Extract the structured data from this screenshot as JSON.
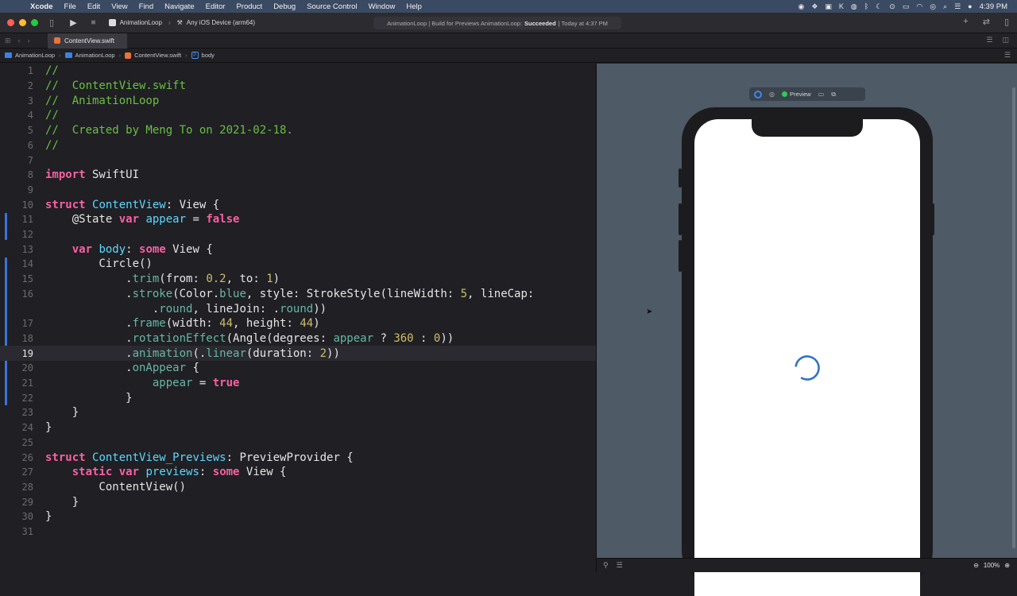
{
  "menubar": {
    "app": "Xcode",
    "items": [
      "File",
      "Edit",
      "View",
      "Find",
      "Navigate",
      "Editor",
      "Product",
      "Debug",
      "Source Control",
      "Window",
      "Help"
    ],
    "clock": "4:39 PM"
  },
  "toolbar": {
    "scheme": "AnimationLoop",
    "device": "Any iOS Device (arm64)",
    "activity_prefix": "AnimationLoop | Build for Previews AnimationLoop:",
    "activity_status": "Succeeded",
    "activity_time": "| Today at 4:37 PM"
  },
  "tab": {
    "label": "ContentView.swift"
  },
  "jumpbar": {
    "crumbs": [
      "AnimationLoop",
      "AnimationLoop",
      "ContentView.swift",
      "body"
    ]
  },
  "editor": {
    "current_line": 19,
    "lines": [
      "1",
      "2",
      "3",
      "4",
      "5",
      "6",
      "7",
      "8",
      "9",
      "10",
      "11",
      "12",
      "13",
      "14",
      "15",
      "16",
      "",
      "17",
      "18",
      "19",
      "20",
      "21",
      "22",
      "23",
      "24",
      "25",
      "26",
      "27",
      "28",
      "29",
      "30",
      "31"
    ]
  },
  "preview": {
    "label": "Preview",
    "zoom": "100%"
  }
}
